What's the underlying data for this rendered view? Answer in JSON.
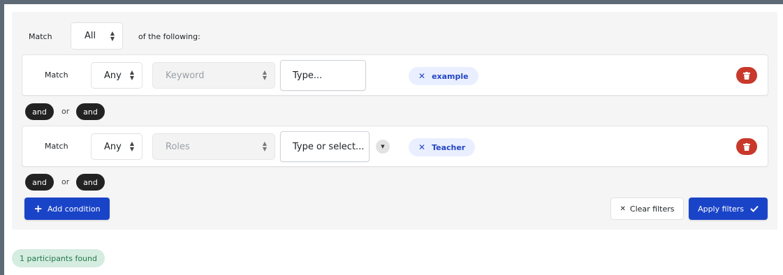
{
  "top": {
    "match_label": "Match",
    "match_select_value": "All",
    "of_following": "of the following:"
  },
  "conditions": [
    {
      "match_label": "Match",
      "match_select_value": "Any",
      "field_select_value": "Keyword",
      "input_placeholder": "Type...",
      "chip_label": "example"
    },
    {
      "match_label": "Match",
      "match_select_value": "Any",
      "field_select_value": "Roles",
      "input_placeholder": "Type or select...",
      "chip_label": "Teacher"
    }
  ],
  "connectors": [
    {
      "left": "and",
      "or": "or",
      "right": "and"
    },
    {
      "left": "and",
      "or": "or",
      "right": "and"
    }
  ],
  "actions": {
    "add_condition": "Add condition",
    "clear_filters": "Clear filters",
    "apply_filters": "Apply filters"
  },
  "result": {
    "count_text": "1 participants found"
  },
  "colors": {
    "primary": "#1a44c8",
    "danger": "#c8392b",
    "chip_bg": "#e9efff",
    "chip_text": "#2546c4",
    "success_bg": "#d5ece0",
    "success_text": "#23784a"
  },
  "icons": {
    "remove_chip": "close-icon",
    "delete_condition": "trash-icon",
    "add": "plus-icon",
    "clear": "close-icon",
    "apply": "check-icon",
    "select_caret": "sort-caret-icon",
    "dropdown_toggle": "chevron-down-icon"
  }
}
